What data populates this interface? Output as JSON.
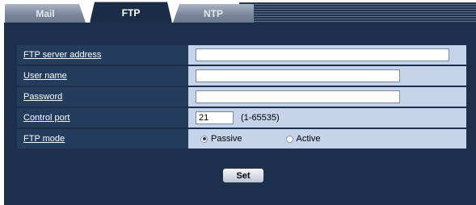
{
  "tabs": [
    {
      "label": "Mail",
      "active": false
    },
    {
      "label": "FTP",
      "active": true
    },
    {
      "label": "NTP",
      "active": false
    }
  ],
  "form": {
    "ftp_server_address": {
      "label": "FTP server address",
      "value": ""
    },
    "user_name": {
      "label": "User name",
      "value": ""
    },
    "password": {
      "label": "Password",
      "value": ""
    },
    "control_port": {
      "label": "Control port",
      "value": "21",
      "range": "(1-65535)"
    },
    "ftp_mode": {
      "label": "FTP mode",
      "selected": "Passive",
      "options": [
        "Passive",
        "Active"
      ]
    }
  },
  "buttons": {
    "set_label": "Set"
  },
  "colors": {
    "panel_bg": "#1c2f4b",
    "label_cell_bg": "#243d5d",
    "value_cell_bg": "#c5d4ea"
  }
}
